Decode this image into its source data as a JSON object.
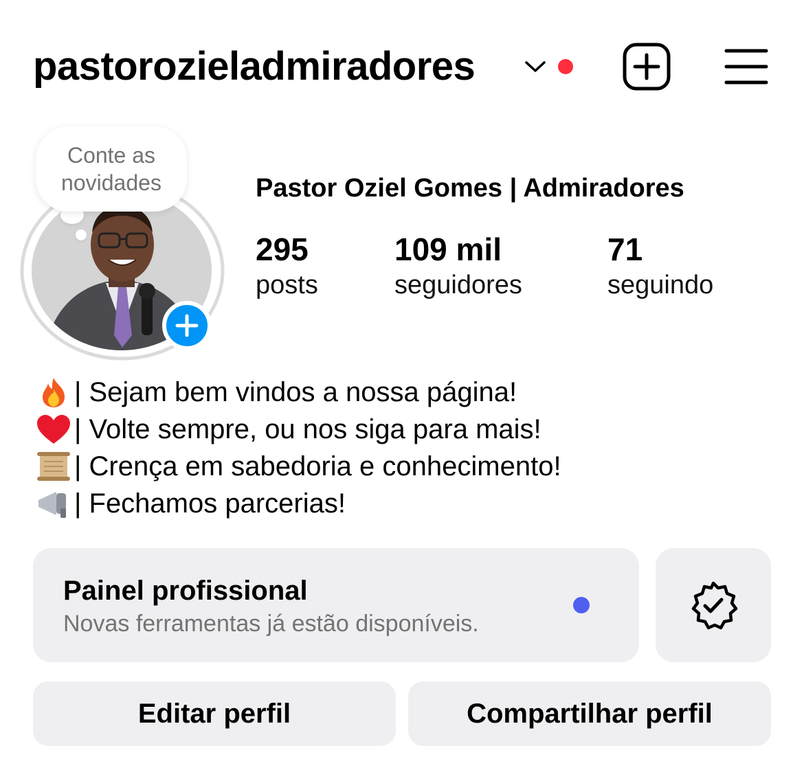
{
  "header": {
    "username": "pastorozieladmiradores",
    "icons": [
      "chevron-down-icon",
      "notification-dot",
      "create-icon",
      "menu-icon"
    ],
    "colors": {
      "notification_dot": "#ff2d3d"
    }
  },
  "avatar": {
    "note_bubble_text_line1": "Conte as",
    "note_bubble_text_line2": "novidades",
    "add_story_icon": "plus-icon",
    "add_color": "#0095f6"
  },
  "profile": {
    "full_name": "Pastor Oziel Gomes | Admiradores",
    "stats": [
      {
        "value": "295",
        "label": "posts"
      },
      {
        "value": "109 mil",
        "label": "seguidores"
      },
      {
        "value": "71",
        "label": "seguindo"
      }
    ]
  },
  "bio": [
    {
      "emoji": "fire-icon",
      "text": "| Sejam bem vindos a nossa página!"
    },
    {
      "emoji": "heart-icon",
      "text": "| Volte sempre, ou nos siga para mais!"
    },
    {
      "emoji": "scroll-icon",
      "text": "| Crença em sabedoria e conhecimento!"
    },
    {
      "emoji": "megaphone-icon",
      "text": "| Fechamos parcerias!"
    }
  ],
  "professional_panel": {
    "title": "Painel profissional",
    "subtitle": "Novas ferramentas já estão disponíveis.",
    "dot_color": "#4f5ff0",
    "side_icon": "verified-badge-icon"
  },
  "buttons": {
    "edit_profile": "Editar perfil",
    "share_profile": "Compartilhar perfil"
  }
}
